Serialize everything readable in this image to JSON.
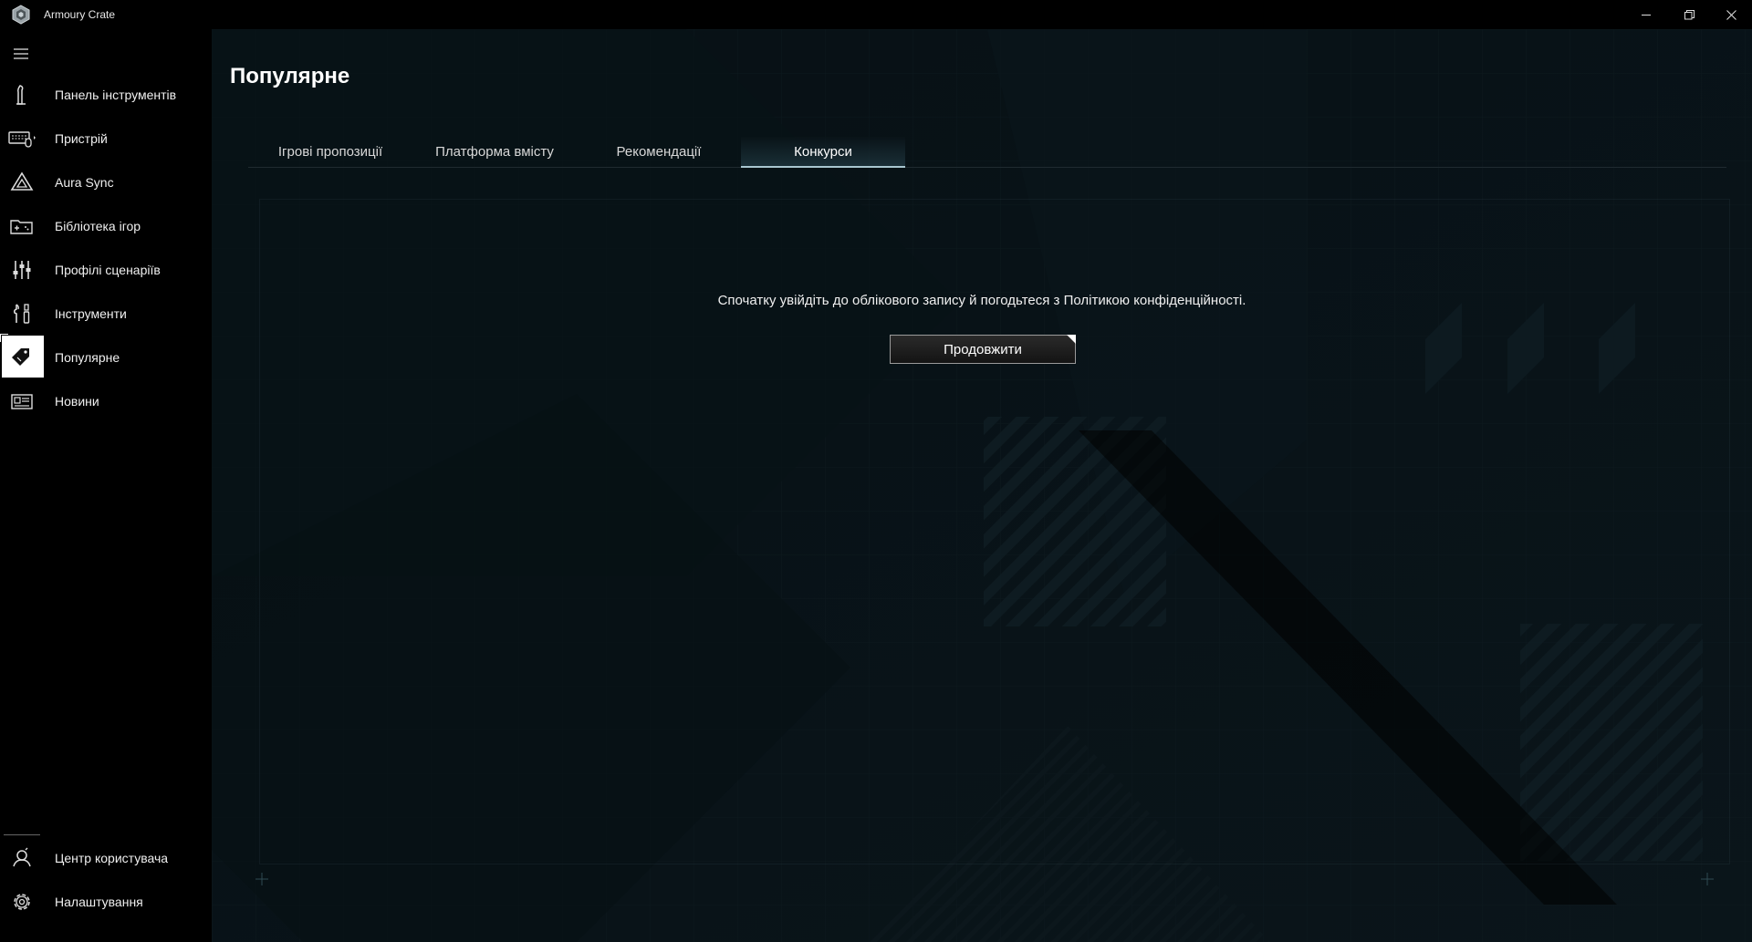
{
  "window": {
    "title": "Armoury Crate",
    "logo_icon": "asus-logo-icon",
    "controls": [
      "minimize-icon",
      "restore-icon",
      "close-icon"
    ]
  },
  "sidebar": {
    "menu_icon": "hamburger-menu-icon",
    "items": [
      {
        "label": "Панель інструментів",
        "icon": "dashboard-icon"
      },
      {
        "label": "Пристрій",
        "icon": "keyboard-device-icon"
      },
      {
        "label": "Aura Sync",
        "icon": "aura-sync-icon"
      },
      {
        "label": "Бібліотека ігор",
        "icon": "game-library-icon"
      },
      {
        "label": "Профілі сценаріїв",
        "icon": "scenario-profiles-icon"
      },
      {
        "label": "Інструменти",
        "icon": "tools-icon"
      },
      {
        "label": "Популярне",
        "icon": "tag-icon",
        "active": true
      },
      {
        "label": "Новини",
        "icon": "news-icon"
      }
    ],
    "bottom_items": [
      {
        "label": "Центр користувача",
        "icon": "user-center-icon"
      },
      {
        "label": "Налаштування",
        "icon": "settings-gear-icon"
      }
    ]
  },
  "main": {
    "title": "Популярне",
    "tabs": [
      {
        "label": "Ігрові пропозиції"
      },
      {
        "label": "Платформа вмісту"
      },
      {
        "label": "Рекомендації"
      },
      {
        "label": "Конкурси",
        "active": true
      }
    ],
    "message": "Спочатку увійдіть до облікового запису й погодьтеся з Політикою конфіденційності.",
    "continue_label": "Продовжити"
  },
  "colors": {
    "background": "#000000",
    "content_background": "#050a0d",
    "active_tab_accent": "#a9c6d0",
    "text": "#ffffff"
  }
}
